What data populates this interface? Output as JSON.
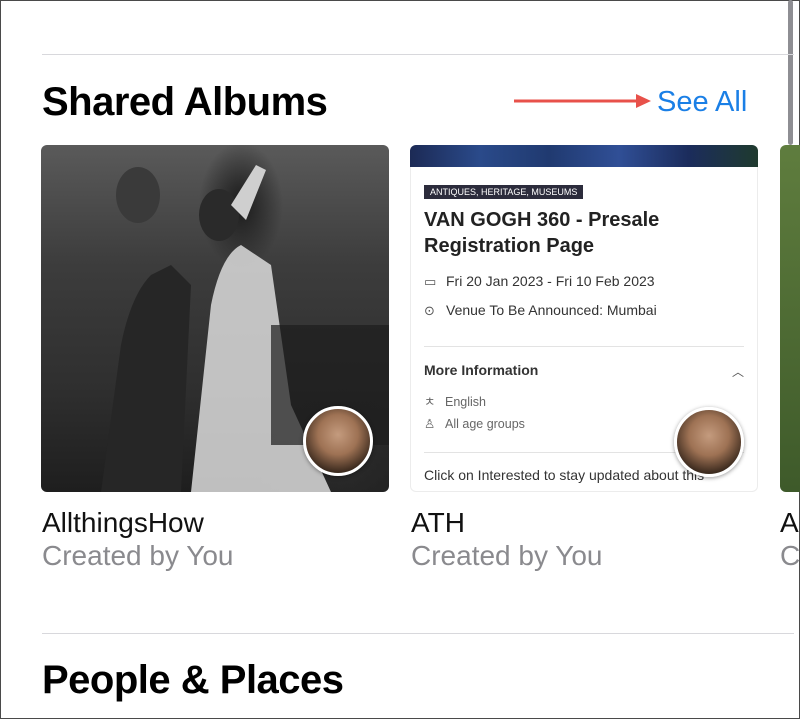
{
  "shared_albums": {
    "title": "Shared Albums",
    "see_all": "See All",
    "albums": [
      {
        "name": "AllthingsHow",
        "subtitle": "Created by You"
      },
      {
        "name": "ATH",
        "subtitle": "Created by You"
      },
      {
        "name": "A",
        "subtitle": "C"
      }
    ]
  },
  "event_doc": {
    "tag": "ANTIQUES, HERITAGE, MUSEUMS",
    "title": "VAN GOGH 360 - Presale Registration Page",
    "date": "Fri 20 Jan 2023 - Fri 10 Feb 2023",
    "venue": "Venue To Be Announced: Mumbai",
    "more_info": "More Information",
    "language": "English",
    "age": "All age groups",
    "footer": "Click on Interested to stay updated about this"
  },
  "people_places": {
    "title": "People & Places"
  },
  "colors": {
    "accent": "#1a7fe6",
    "annotation_arrow": "#e8514a",
    "secondary_text": "#8a8a8e"
  }
}
